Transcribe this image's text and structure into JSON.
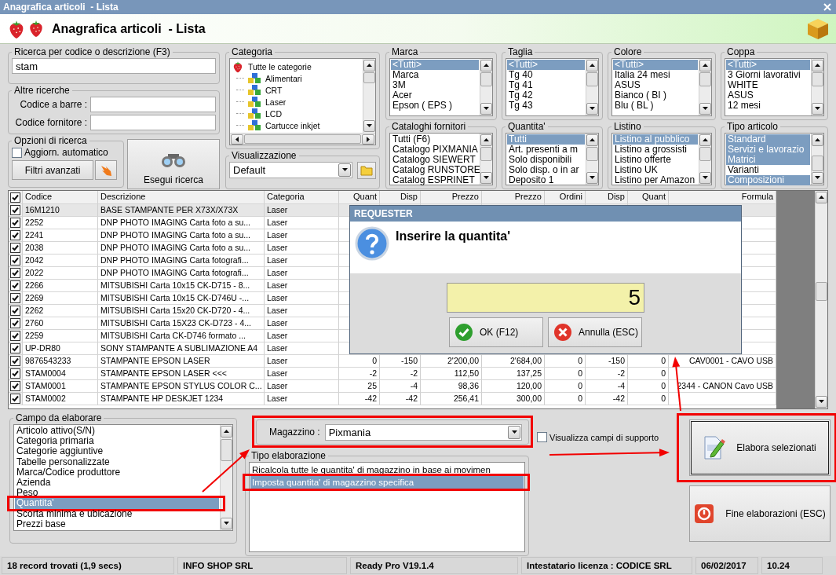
{
  "window": {
    "title": "Anagrafica articoli  - Lista"
  },
  "header": {
    "title": "Anagrafica articoli  - Lista"
  },
  "search": {
    "label": "Ricerca per codice o descrizione (F3)",
    "value": "stam"
  },
  "other_searches": {
    "label": "Altre ricerche",
    "fields": [
      {
        "label": "Codice a barre :"
      },
      {
        "label": "Codice fornitore :"
      }
    ]
  },
  "search_options": {
    "label": "Opzioni di ricerca",
    "auto_update": {
      "label": "Aggiorn. automatico",
      "checked": false
    },
    "advanced_button": "Filtri avanzati"
  },
  "run_search_button": "Esegui ricerca",
  "category": {
    "label": "Categoria",
    "tree": [
      {
        "label": "Tutte le categorie",
        "children": [
          {
            "label": "Alimentari"
          },
          {
            "label": "CRT"
          },
          {
            "label": "Laser"
          },
          {
            "label": "LCD"
          },
          {
            "label": "Cartucce inkjet"
          }
        ]
      }
    ]
  },
  "view": {
    "label": "Visualizzazione",
    "value": "Default"
  },
  "filters": [
    {
      "label": "Marca",
      "items": [
        {
          "label": "<Tutti>",
          "selected": true
        },
        {
          "label": "Marca",
          "selected": false
        },
        {
          "label": "3M",
          "selected": false
        },
        {
          "label": "Acer",
          "selected": false
        },
        {
          "label": "Epson ( EPS )",
          "selected": false
        }
      ]
    },
    {
      "label": "Taglia",
      "items": [
        {
          "label": "<Tutti>",
          "selected": true
        },
        {
          "label": "Tg 40",
          "selected": false
        },
        {
          "label": "Tg 41",
          "selected": false
        },
        {
          "label": "Tg 42",
          "selected": false
        },
        {
          "label": "Tg 43",
          "selected": false
        }
      ]
    },
    {
      "label": "Colore",
      "items": [
        {
          "label": "<Tutti>",
          "selected": true
        },
        {
          "label": "Italia 24 mesi",
          "selected": false
        },
        {
          "label": "ASUS",
          "selected": false
        },
        {
          "label": "Bianco ( BI )",
          "selected": false
        },
        {
          "label": "Blu ( BL )",
          "selected": false
        }
      ]
    },
    {
      "label": "Coppa",
      "items": [
        {
          "label": "<Tutti>",
          "selected": true
        },
        {
          "label": "3 Giorni lavorativi",
          "selected": false
        },
        {
          "label": "WHITE",
          "selected": false
        },
        {
          "label": "ASUS",
          "selected": false
        },
        {
          "label": "12 mesi",
          "selected": false
        }
      ]
    },
    {
      "label": "Cataloghi fornitori",
      "items": [
        {
          "label": "Tutti (F6)",
          "selected": false
        },
        {
          "label": "Catalogo PIXMANIA",
          "selected": false
        },
        {
          "label": "Catalogo SIEWERT",
          "selected": false
        },
        {
          "label": "Catalog RUNSTORE",
          "selected": false
        },
        {
          "label": "Catalog ESPRINET",
          "selected": false
        }
      ]
    },
    {
      "label": "Quantita'",
      "items": [
        {
          "label": "Tutti",
          "selected": true
        },
        {
          "label": "Art. presenti a m",
          "selected": false
        },
        {
          "label": "Solo disponibili",
          "selected": false
        },
        {
          "label": "Solo disp. o in ar",
          "selected": false
        },
        {
          "label": "Deposito 1",
          "selected": false
        }
      ]
    },
    {
      "label": "Listino",
      "items": [
        {
          "label": "Listino al pubblico",
          "selected": true
        },
        {
          "label": "Listino a grossisti",
          "selected": false
        },
        {
          "label": "Listino offerte",
          "selected": false
        },
        {
          "label": "Listino UK",
          "selected": false
        },
        {
          "label": "Listino per Amazon",
          "selected": false
        }
      ]
    },
    {
      "label": "Tipo articolo",
      "items": [
        {
          "label": "Standard",
          "selected": true
        },
        {
          "label": "Servizi e lavorazio",
          "selected": true
        },
        {
          "label": "Matrici",
          "selected": true
        },
        {
          "label": "Varianti",
          "selected": false
        },
        {
          "label": "Composizioni",
          "selected": true
        }
      ]
    }
  ],
  "table": {
    "header_checked": true,
    "columns": [
      "Codice",
      "Descrizione",
      "Categoria",
      "Quant",
      "Disp",
      "Prezzo",
      "Prezzo",
      "Ordini",
      "Disp",
      "Quant",
      "Formula"
    ],
    "rows": [
      {
        "checked": true,
        "selected": true,
        "cells": [
          "16M1210",
          "BASE STAMPANTE PER X73X/X73X",
          "Laser"
        ]
      },
      {
        "checked": true,
        "selected": false,
        "cells": [
          "2252",
          "DNP PHOTO IMAGING Carta foto a su...",
          "Laser"
        ]
      },
      {
        "checked": true,
        "selected": false,
        "cells": [
          "2241",
          "DNP PHOTO IMAGING Carta foto a su...",
          "Laser"
        ]
      },
      {
        "checked": true,
        "selected": false,
        "cells": [
          "2038",
          "DNP PHOTO IMAGING Carta foto a su...",
          "Laser"
        ]
      },
      {
        "checked": true,
        "selected": false,
        "cells": [
          "2042",
          "DNP PHOTO IMAGING Carta fotografi...",
          "Laser"
        ]
      },
      {
        "checked": true,
        "selected": false,
        "cells": [
          "2022",
          "DNP PHOTO IMAGING Carta fotografi...",
          "Laser"
        ]
      },
      {
        "checked": true,
        "selected": false,
        "cells": [
          "2266",
          "MITSUBISHI Carta 10x15 CK-D715 - 8...",
          "Laser"
        ]
      },
      {
        "checked": true,
        "selected": false,
        "cells": [
          "2269",
          "MITSUBISHI Carta 10x15 CK-D746U -...",
          "Laser"
        ]
      },
      {
        "checked": true,
        "selected": false,
        "cells": [
          "2262",
          "MITSUBISHI Carta 15x20 CK-D720 - 4...",
          "Laser"
        ]
      },
      {
        "checked": true,
        "selected": false,
        "cells": [
          "2760",
          "MITSUBISHI Carta 15X23 CK-D723 - 4...",
          "Laser"
        ]
      },
      {
        "checked": true,
        "selected": false,
        "cells": [
          "2259",
          "MITSUBISHI Carta CK-D746 formato ...",
          "Laser"
        ]
      },
      {
        "checked": true,
        "selected": false,
        "cells": [
          "UP-DR80",
          "SONY STAMPANTE A SUBLIMAZIONE A4",
          "Laser"
        ]
      },
      {
        "checked": true,
        "selected": false,
        "cells": [
          "9876543233",
          "STAMPANTE EPSON LASER",
          "Laser",
          "0",
          "-150",
          "2'200,00",
          "2'684,00",
          "0",
          "-150",
          "0",
          "CAV0001 - CAVO USB"
        ]
      },
      {
        "checked": true,
        "selected": false,
        "cells": [
          "STAM0004",
          "STAMPANTE EPSON LASER <<<",
          "Laser",
          "-2",
          "-2",
          "112,50",
          "137,25",
          "0",
          "-2",
          "0"
        ]
      },
      {
        "checked": true,
        "selected": false,
        "cells": [
          "STAM0001",
          "STAMPANTE EPSON STYLUS COLOR C...",
          "Laser",
          "25",
          "-4",
          "98,36",
          "120,00",
          "0",
          "-4",
          "0",
          "2344 - CANON Cavo USB"
        ]
      },
      {
        "checked": true,
        "selected": false,
        "cells": [
          "STAM0002",
          "STAMPANTE HP DESKJET 1234",
          "Laser",
          "-42",
          "-42",
          "256,41",
          "300,00",
          "0",
          "-42",
          "0"
        ]
      }
    ]
  },
  "dialog": {
    "title": "REQUESTER",
    "message": "Inserire la quantita'",
    "value": "5",
    "buttons": [
      {
        "kind": "ok",
        "label": "OK (F12)"
      },
      {
        "kind": "cancel",
        "label": "Annulla (ESC)"
      }
    ]
  },
  "field_to_process": {
    "label": "Campo da elaborare",
    "items": [
      {
        "label": "Articolo attivo(S/N)",
        "selected": false
      },
      {
        "label": "Categoria primaria",
        "selected": false
      },
      {
        "label": "Categorie aggiuntive",
        "selected": false
      },
      {
        "label": "Tabelle personalizzate",
        "selected": false
      },
      {
        "label": "Marca/Codice produttore",
        "selected": false
      },
      {
        "label": "Azienda",
        "selected": false
      },
      {
        "label": "Peso",
        "selected": false
      },
      {
        "label": "Quantita'",
        "selected": true
      },
      {
        "label": "Scorta minima e ubicazione",
        "selected": false
      },
      {
        "label": "Prezzi base",
        "selected": false
      }
    ]
  },
  "warehouse": {
    "label": "Magazzino :",
    "value": "Pixmania"
  },
  "processing_type": {
    "label": "Tipo elaborazione",
    "items": [
      {
        "label": "Ricalcola tutte le quantita' di magazzino in base ai movimen",
        "selected": false
      },
      {
        "label": "Imposta quantita' di magazzino specifica",
        "selected": true
      }
    ]
  },
  "support_fields": {
    "label": "Visualizza campi di supporto",
    "checked": false
  },
  "actions": [
    {
      "kind": "process",
      "label": "Elabora selezionati",
      "focused": true
    },
    {
      "kind": "close",
      "label": "Fine elaborazioni (ESC)",
      "focused": false
    }
  ],
  "status_bar": [
    "18 record trovati (1,9 secs)",
    "INFO SHOP SRL",
    "Ready Pro V19.1.4",
    "Intestatario licenza : CODICE SRL",
    "06/02/2017",
    "10.24"
  ]
}
